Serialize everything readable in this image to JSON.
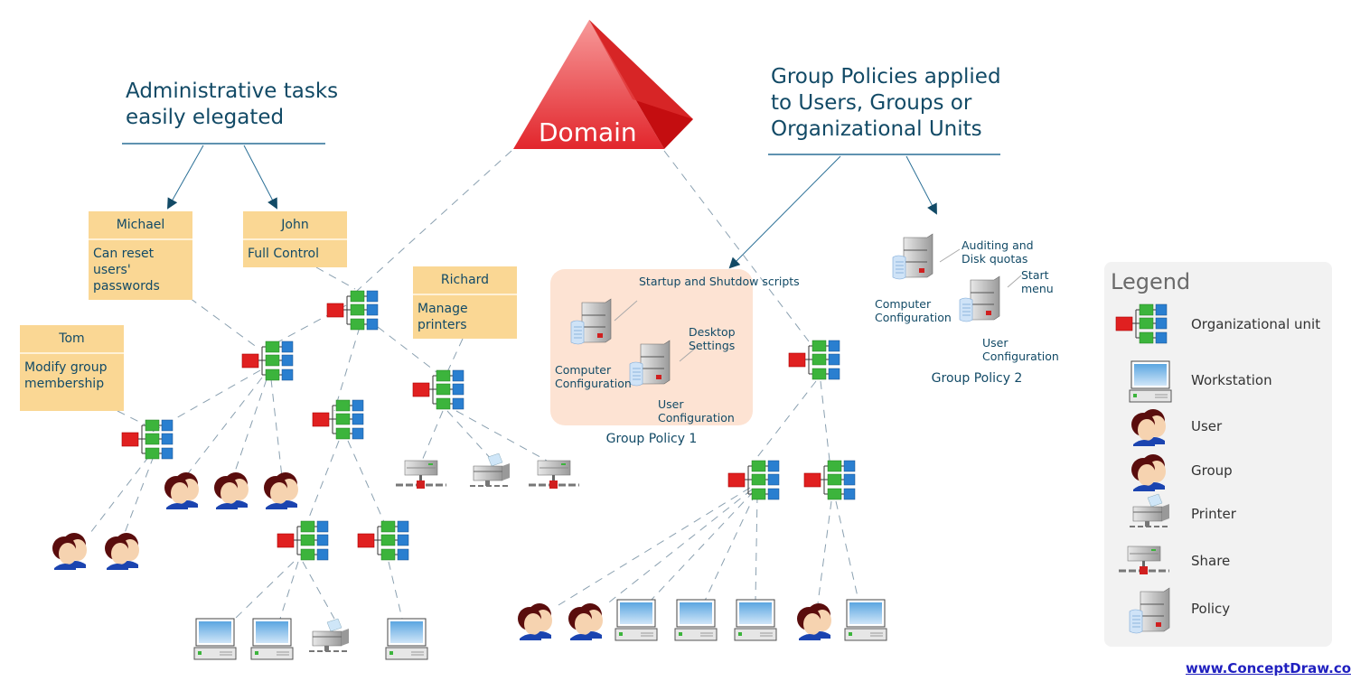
{
  "headings": {
    "admin": [
      "Administrative tasks",
      "easily elegated"
    ],
    "policies": [
      "Group Policies applied",
      "to Users, Groups or",
      "Organizational Units"
    ]
  },
  "domain": {
    "label": "Domain",
    "color": "#e2262c"
  },
  "delegates": [
    {
      "name": "Michael",
      "task": "Can reset users' passwords"
    },
    {
      "name": "John",
      "task": "Full Control"
    },
    {
      "name": "Tom",
      "task": "Modify group membership"
    },
    {
      "name": "Richard",
      "task": "Manage printers"
    }
  ],
  "group_policies": [
    {
      "name": "Group Policy 1",
      "computer_label": "Computer Configuration",
      "computer_setting": "Startup and Shutdow scripts",
      "user_label": "User Configuration",
      "user_setting": "Desktop Settings"
    },
    {
      "name": "Group Policy 2",
      "computer_label": "Computer Configuration",
      "computer_setting": "Auditing and Disk quotas",
      "user_label": "User Configuration",
      "user_setting": "Start menu"
    }
  ],
  "legend": {
    "title": "Legend",
    "items": [
      {
        "icon": "organizational-unit-icon",
        "label": "Organizational unit"
      },
      {
        "icon": "workstation-icon",
        "label": "Workstation"
      },
      {
        "icon": "user-icon",
        "label": "User"
      },
      {
        "icon": "group-icon",
        "label": "Group"
      },
      {
        "icon": "printer-icon",
        "label": "Printer"
      },
      {
        "icon": "share-icon",
        "label": "Share"
      },
      {
        "icon": "policy-icon",
        "label": "Policy"
      }
    ]
  },
  "footer": {
    "link": "www.ConceptDraw.com"
  },
  "colors": {
    "heading": "#124a66",
    "card": "#fad794",
    "policy_box": "#fde3d3",
    "ou_red": "#e02020",
    "ou_green": "#3cb43c",
    "ou_blue": "#2a7fd0"
  }
}
